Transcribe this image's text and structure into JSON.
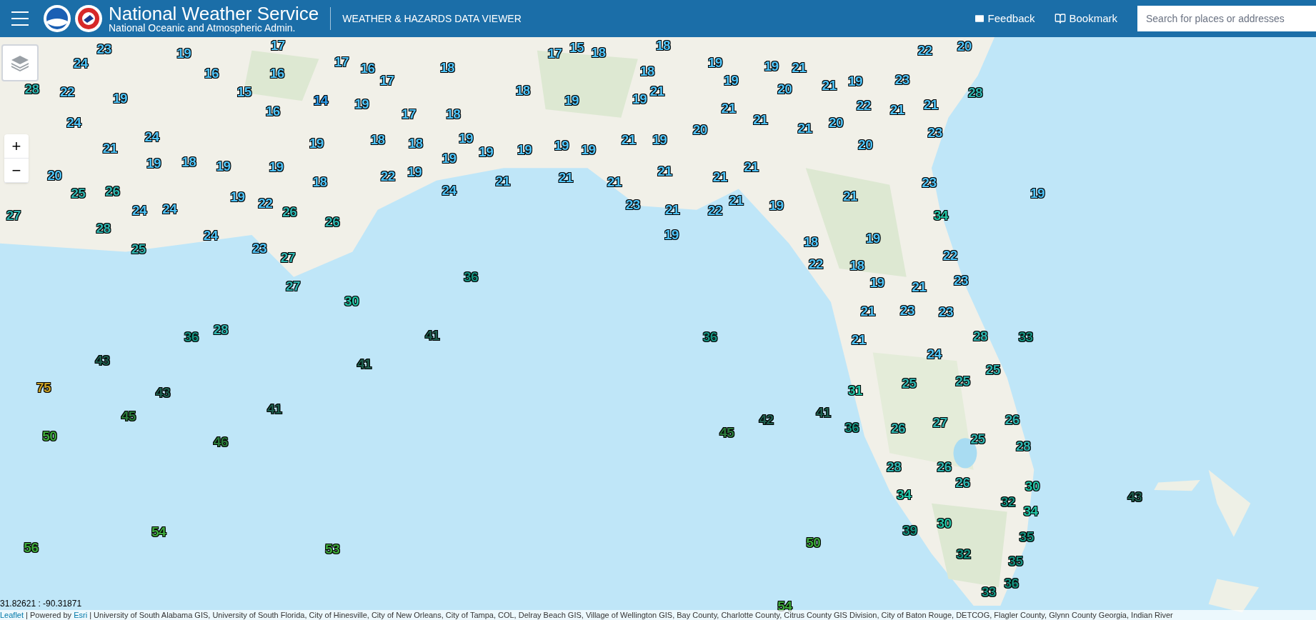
{
  "header": {
    "title": "National Weather Service",
    "subtitle": "National Oceanic and Atmospheric Admin.",
    "app_name": "WEATHER & HAZARDS DATA VIEWER",
    "links": [
      "Feedback",
      "Bookmark"
    ],
    "search": {
      "placeholder": "Search for places or addresses"
    }
  },
  "map": {
    "kind": "picture",
    "zoom_controls": [
      "+",
      "−"
    ],
    "coordinates": "31.82621 : -90.31871",
    "attribution": {
      "leaflet": "Leaflet",
      "separator": "| Powered by",
      "esri": "Esri",
      "sources": "| University of South Alabama GIS, University of South Florida, City of Hinesville, City of New Orleans, City of Tampa, COL, Delray Beach GIS, Village of Wellington GIS, Bay County, Charlotte County, Citrus County GIS Division, City of Baton Rouge, DETCOG, Flagler County, Glynn County Georgia, Indian River"
    },
    "markers": [
      {
        "value": "23",
        "color": "#4fc3f7"
      },
      {
        "value": "19",
        "color": "#4fc3f7"
      },
      {
        "value": "17",
        "color": "#4fc3f7"
      },
      {
        "value": "17",
        "color": "#4fc3f7"
      },
      {
        "value": "15",
        "color": "#4fc3f7"
      },
      {
        "value": "18",
        "color": "#4fc3f7"
      },
      {
        "value": "18",
        "color": "#4fc3f7"
      },
      {
        "value": "22",
        "color": "#4fc3f7"
      },
      {
        "value": "20",
        "color": "#4fc3f7"
      },
      {
        "value": "24",
        "color": "#4fc3f7"
      },
      {
        "value": "16",
        "color": "#4fc3f7"
      },
      {
        "value": "16",
        "color": "#4fc3f7"
      },
      {
        "value": "17",
        "color": "#4fc3f7"
      },
      {
        "value": "16",
        "color": "#4fc3f7"
      },
      {
        "value": "18",
        "color": "#4fc3f7"
      },
      {
        "value": "18",
        "color": "#4fc3f7"
      },
      {
        "value": "19",
        "color": "#4fc3f7"
      },
      {
        "value": "19",
        "color": "#4fc3f7"
      },
      {
        "value": "21",
        "color": "#4fc3f7"
      },
      {
        "value": "28",
        "color": "#2fb3ae"
      },
      {
        "value": "22",
        "color": "#4fc3f7"
      },
      {
        "value": "19",
        "color": "#4fc3f7"
      },
      {
        "value": "15",
        "color": "#4fc3f7"
      },
      {
        "value": "14",
        "color": "#2f9be8"
      },
      {
        "value": "19",
        "color": "#4fc3f7"
      },
      {
        "value": "17",
        "color": "#4fc3f7"
      },
      {
        "value": "18",
        "color": "#4fc3f7"
      },
      {
        "value": "19",
        "color": "#4fc3f7"
      },
      {
        "value": "19",
        "color": "#4fc3f7"
      },
      {
        "value": "21",
        "color": "#4fc3f7"
      },
      {
        "value": "19",
        "color": "#4fc3f7"
      },
      {
        "value": "20",
        "color": "#4fc3f7"
      },
      {
        "value": "21",
        "color": "#4fc3f7"
      },
      {
        "value": "19",
        "color": "#4fc3f7"
      },
      {
        "value": "22",
        "color": "#4fc3f7"
      },
      {
        "value": "23",
        "color": "#4fc3f7"
      },
      {
        "value": "21",
        "color": "#4fc3f7"
      },
      {
        "value": "28",
        "color": "#2fb3ae"
      },
      {
        "value": "24",
        "color": "#4fc3f7"
      },
      {
        "value": "16",
        "color": "#4fc3f7"
      },
      {
        "value": "17",
        "color": "#4fc3f7"
      },
      {
        "value": "18",
        "color": "#4fc3f7"
      },
      {
        "value": "21",
        "color": "#4fc3f7"
      },
      {
        "value": "21",
        "color": "#4fc3f7"
      },
      {
        "value": "20",
        "color": "#4fc3f7"
      },
      {
        "value": "21",
        "color": "#4fc3f7"
      },
      {
        "value": "21",
        "color": "#4fc3f7"
      },
      {
        "value": "24",
        "color": "#4fc3f7"
      },
      {
        "value": "19",
        "color": "#4fc3f7"
      },
      {
        "value": "18",
        "color": "#4fc3f7"
      },
      {
        "value": "18",
        "color": "#4fc3f7"
      },
      {
        "value": "19",
        "color": "#4fc3f7"
      },
      {
        "value": "19",
        "color": "#4fc3f7"
      },
      {
        "value": "19",
        "color": "#4fc3f7"
      },
      {
        "value": "19",
        "color": "#4fc3f7"
      },
      {
        "value": "19",
        "color": "#4fc3f7"
      },
      {
        "value": "21",
        "color": "#4fc3f7"
      },
      {
        "value": "19",
        "color": "#4fc3f7"
      },
      {
        "value": "20",
        "color": "#4fc3f7"
      },
      {
        "value": "21",
        "color": "#4fc3f7"
      },
      {
        "value": "20",
        "color": "#4fc3f7"
      },
      {
        "value": "23",
        "color": "#4fc3f7"
      },
      {
        "value": "20",
        "color": "#4fc3f7"
      },
      {
        "value": "19",
        "color": "#4fc3f7"
      },
      {
        "value": "18",
        "color": "#4fc3f7"
      },
      {
        "value": "19",
        "color": "#4fc3f7"
      },
      {
        "value": "19",
        "color": "#4fc3f7"
      },
      {
        "value": "18",
        "color": "#4fc3f7"
      },
      {
        "value": "22",
        "color": "#4fc3f7"
      },
      {
        "value": "19",
        "color": "#4fc3f7"
      },
      {
        "value": "19",
        "color": "#4fc3f7"
      },
      {
        "value": "21",
        "color": "#4fc3f7"
      },
      {
        "value": "21",
        "color": "#4fc3f7"
      },
      {
        "value": "21",
        "color": "#4fc3f7"
      },
      {
        "value": "21",
        "color": "#4fc3f7"
      },
      {
        "value": "21",
        "color": "#4fc3f7"
      },
      {
        "value": "21",
        "color": "#4fc3f7"
      },
      {
        "value": "23",
        "color": "#4fc3f7"
      },
      {
        "value": "27",
        "color": "#2fb3ae"
      },
      {
        "value": "25",
        "color": "#2fb3ae"
      },
      {
        "value": "26",
        "color": "#2fb3ae"
      },
      {
        "value": "24",
        "color": "#4fc3f7"
      },
      {
        "value": "24",
        "color": "#4fc3f7"
      },
      {
        "value": "19",
        "color": "#4fc3f7"
      },
      {
        "value": "22",
        "color": "#4fc3f7"
      },
      {
        "value": "26",
        "color": "#2fb3ae"
      },
      {
        "value": "24",
        "color": "#4fc3f7"
      },
      {
        "value": "23",
        "color": "#4fc3f7"
      },
      {
        "value": "21",
        "color": "#4fc3f7"
      },
      {
        "value": "22",
        "color": "#4fc3f7"
      },
      {
        "value": "21",
        "color": "#4fc3f7"
      },
      {
        "value": "19",
        "color": "#4fc3f7"
      },
      {
        "value": "21",
        "color": "#4fc3f7"
      },
      {
        "value": "34",
        "color": "#24c4a6"
      },
      {
        "value": "19",
        "color": "#4fc3f7"
      },
      {
        "value": "28",
        "color": "#2fb3ae"
      },
      {
        "value": "25",
        "color": "#2fb3ae"
      },
      {
        "value": "24",
        "color": "#4fc3f7"
      },
      {
        "value": "23",
        "color": "#4fc3f7"
      },
      {
        "value": "27",
        "color": "#2fb3ae"
      },
      {
        "value": "26",
        "color": "#2fb3ae"
      },
      {
        "value": "19",
        "color": "#4fc3f7"
      },
      {
        "value": "18",
        "color": "#4fc3f7"
      },
      {
        "value": "19",
        "color": "#4fc3f7"
      },
      {
        "value": "22",
        "color": "#4fc3f7"
      },
      {
        "value": "27",
        "color": "#2fb3ae"
      },
      {
        "value": "36",
        "color": "#16907f"
      },
      {
        "value": "22",
        "color": "#4fc3f7"
      },
      {
        "value": "18",
        "color": "#4fc3f7"
      },
      {
        "value": "19",
        "color": "#4fc3f7"
      },
      {
        "value": "21",
        "color": "#4fc3f7"
      },
      {
        "value": "23",
        "color": "#4fc3f7"
      },
      {
        "value": "30",
        "color": "#24c4a6"
      },
      {
        "value": "21",
        "color": "#4fc3f7"
      },
      {
        "value": "23",
        "color": "#4fc3f7"
      },
      {
        "value": "23",
        "color": "#4fc3f7"
      },
      {
        "value": "36",
        "color": "#16907f"
      },
      {
        "value": "28",
        "color": "#2fb3ae"
      },
      {
        "value": "41",
        "color": "#1e5e4e"
      },
      {
        "value": "36",
        "color": "#16907f"
      },
      {
        "value": "21",
        "color": "#4fc3f7"
      },
      {
        "value": "28",
        "color": "#2fb3ae"
      },
      {
        "value": "33",
        "color": "#16907f"
      },
      {
        "value": "43",
        "color": "#1e5e4e"
      },
      {
        "value": "41",
        "color": "#1e5e4e"
      },
      {
        "value": "24",
        "color": "#4fc3f7"
      },
      {
        "value": "25",
        "color": "#2fb3ae"
      },
      {
        "value": "75",
        "color": "#c9a227"
      },
      {
        "value": "43",
        "color": "#1e5e4e"
      },
      {
        "value": "31",
        "color": "#24c4a6"
      },
      {
        "value": "25",
        "color": "#2fb3ae"
      },
      {
        "value": "25",
        "color": "#2fb3ae"
      },
      {
        "value": "45",
        "color": "#2a7a3a"
      },
      {
        "value": "41",
        "color": "#1e5e4e"
      },
      {
        "value": "42",
        "color": "#1e5e4e"
      },
      {
        "value": "41",
        "color": "#1e5e4e"
      },
      {
        "value": "36",
        "color": "#16907f"
      },
      {
        "value": "26",
        "color": "#2fb3ae"
      },
      {
        "value": "27",
        "color": "#2fb3ae"
      },
      {
        "value": "26",
        "color": "#2fb3ae"
      },
      {
        "value": "50",
        "color": "#3da83b"
      },
      {
        "value": "46",
        "color": "#2a7a3a"
      },
      {
        "value": "45",
        "color": "#2a7a3a"
      },
      {
        "value": "25",
        "color": "#2fb3ae"
      },
      {
        "value": "28",
        "color": "#2fb3ae"
      },
      {
        "value": "28",
        "color": "#2fb3ae"
      },
      {
        "value": "26",
        "color": "#2fb3ae"
      },
      {
        "value": "26",
        "color": "#2fb3ae"
      },
      {
        "value": "30",
        "color": "#24c4a6"
      },
      {
        "value": "34",
        "color": "#24c4a6"
      },
      {
        "value": "32",
        "color": "#16907f"
      },
      {
        "value": "34",
        "color": "#24c4a6"
      },
      {
        "value": "43",
        "color": "#1e5e4e"
      },
      {
        "value": "56",
        "color": "#3da83b"
      },
      {
        "value": "54",
        "color": "#3da83b"
      },
      {
        "value": "53",
        "color": "#3da83b"
      },
      {
        "value": "50",
        "color": "#3da83b"
      },
      {
        "value": "39",
        "color": "#16907f"
      },
      {
        "value": "30",
        "color": "#24c4a6"
      },
      {
        "value": "32",
        "color": "#16907f"
      },
      {
        "value": "35",
        "color": "#16907f"
      },
      {
        "value": "35",
        "color": "#16907f"
      },
      {
        "value": "54",
        "color": "#3da83b"
      },
      {
        "value": "33",
        "color": "#16907f"
      },
      {
        "value": "36",
        "color": "#16907f"
      }
    ]
  }
}
